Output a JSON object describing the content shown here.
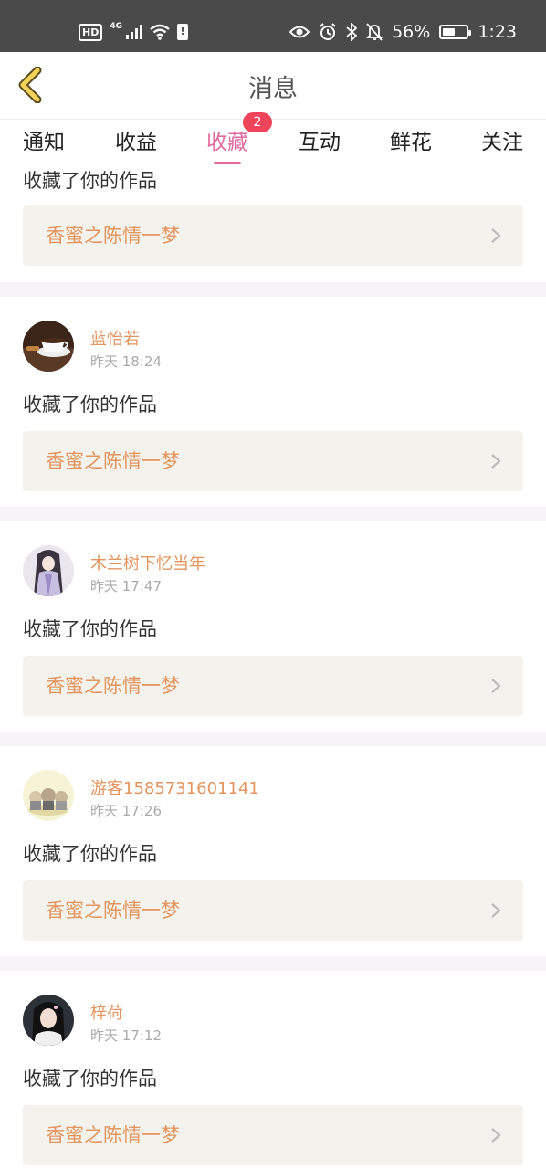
{
  "status_bar": {
    "hd": "HD",
    "network": "4G",
    "battery_percent": "56%",
    "battery_level": 0.56,
    "time": "1:23"
  },
  "header": {
    "title": "消息"
  },
  "tabs": [
    {
      "label": "通知",
      "active": false
    },
    {
      "label": "收益",
      "active": false
    },
    {
      "label": "收藏",
      "active": true,
      "badge": "2"
    },
    {
      "label": "互动",
      "active": false
    },
    {
      "label": "鲜花",
      "active": false
    },
    {
      "label": "关注",
      "active": false
    }
  ],
  "partial_card": {
    "action": "收藏了你的作品",
    "work_title": "香蜜之陈情一梦"
  },
  "messages": [
    {
      "user": "蓝怡若",
      "time": "昨天 18:24",
      "action": "收藏了你的作品",
      "work_title": "香蜜之陈情一梦",
      "avatar_icon": "coffee-cup-avatar"
    },
    {
      "user": "木兰树下忆当年",
      "time": "昨天 17:47",
      "action": "收藏了你的作品",
      "work_title": "香蜜之陈情一梦",
      "avatar_icon": "ancient-lady-avatar"
    },
    {
      "user": "游客1585731601141",
      "time": "昨天 17:26",
      "action": "收藏了你的作品",
      "work_title": "香蜜之陈情一梦",
      "avatar_icon": "cartoon-group-avatar"
    },
    {
      "user": "梓荷",
      "time": "昨天 17:12",
      "action": "收藏了你的作品",
      "work_title": "香蜜之陈情一梦",
      "avatar_icon": "portrait-avatar"
    }
  ],
  "colors": {
    "accent": "#e06b9f",
    "username": "#e3955f",
    "badge": "#f0445a",
    "work_box_bg": "#f3f2ec"
  }
}
